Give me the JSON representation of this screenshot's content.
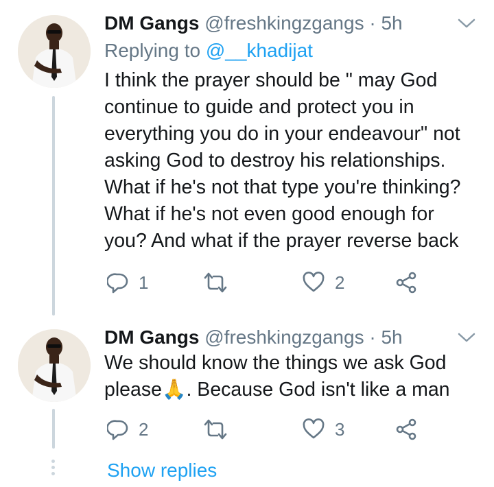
{
  "tweets": [
    {
      "author_name": "DM Gangs",
      "author_handle": "@freshkingzgangs",
      "separator": "·",
      "time": "5h",
      "replying_prefix": "Replying to",
      "replying_to": "@__khadijat",
      "lines": [
        "I think the prayer should be \" may God",
        "continue to guide and protect you in",
        "everything you do in your endeavour\" not",
        "asking God to destroy his relationships.",
        "What if he's not that type you're thinking?",
        "What if he's not even good enough for",
        "you? And what if the prayer reverse back"
      ],
      "reply_count": "1",
      "retweet_count": "",
      "like_count": "2",
      "icons": {
        "avatar": "profile-photo-icon",
        "menu": "chevron-down-icon",
        "reply": "reply-icon",
        "retweet": "retweet-icon",
        "like": "heart-icon",
        "share": "share-icon"
      }
    },
    {
      "author_name": "DM Gangs",
      "author_handle": "@freshkingzgangs",
      "separator": "·",
      "time": "5h",
      "lines": [
        "We should know the things we ask God",
        "please🙏. Because God isn't like a man"
      ],
      "reply_count": "2",
      "retweet_count": "",
      "like_count": "3",
      "icons": {
        "avatar": "profile-photo-icon",
        "menu": "chevron-down-icon",
        "reply": "reply-icon",
        "retweet": "retweet-icon",
        "like": "heart-icon",
        "share": "share-icon"
      }
    }
  ],
  "show_replies": "Show replies",
  "colors": {
    "link": "#1da1f2",
    "muted": "#657786",
    "text": "#14171a",
    "thread_line": "#ccd6dd"
  }
}
